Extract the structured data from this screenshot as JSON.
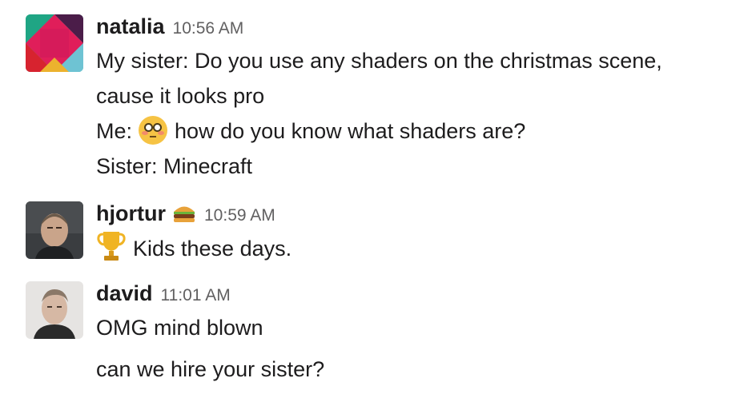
{
  "messages": [
    {
      "user": "natalia",
      "time": "10:56 AM",
      "avatar_icon": "natalia-logo-avatar",
      "lines": [
        "My sister: Do you use any shaders on the christmas scene,",
        "cause it looks pro",
        "how do you know what shaders are?",
        "Sister: Minecraft"
      ],
      "line3_prefix": "Me: ",
      "line3_emoji": "flushed-face-emoji"
    },
    {
      "user": "hjortur",
      "status_emoji": "hamburger-emoji",
      "time": "10:59 AM",
      "avatar_icon": "hjortur-photo-avatar",
      "lines": [
        "Kids these days."
      ],
      "line1_emoji": "trophy-emoji"
    },
    {
      "user": "david",
      "time": "11:01 AM",
      "avatar_icon": "david-photo-avatar",
      "lines": [
        "OMG mind blown",
        "can we hire your sister?"
      ]
    }
  ],
  "colors": {
    "text": "#1d1c1d",
    "timestamp": "#616061",
    "background": "#ffffff"
  }
}
